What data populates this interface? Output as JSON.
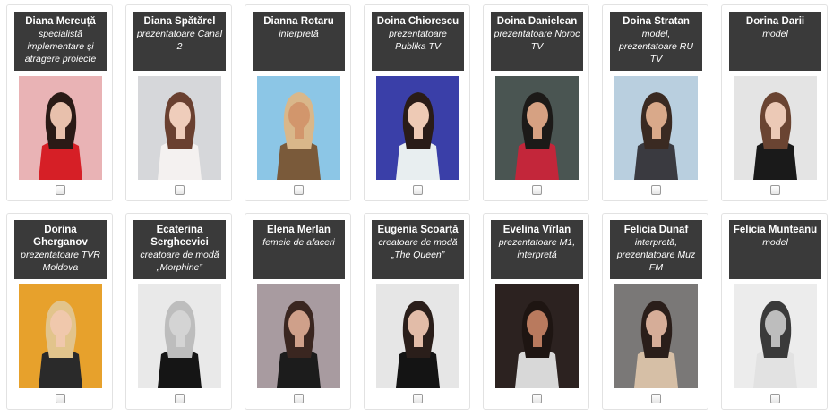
{
  "cards": [
    {
      "name": "Diana Mereuță",
      "role": "specialistă implementare și atragere proiecte",
      "checked": false,
      "colors": {
        "bg": "#e9b3b5",
        "hair": "#2a1a16",
        "skin": "#e8c0ac",
        "outfit": "#d61f26"
      }
    },
    {
      "name": "Diana Spătărel",
      "role": "prezentatoare Canal 2",
      "checked": false,
      "colors": {
        "bg": "#d6d7da",
        "hair": "#6a4030",
        "skin": "#efcdbb",
        "outfit": "#f4f1f0"
      }
    },
    {
      "name": "Dianna Rotaru",
      "role": "interpretă",
      "checked": false,
      "colors": {
        "bg": "#8cc6e6",
        "hair": "#d9b78a",
        "skin": "#d2966c",
        "outfit": "#7a5a3a"
      }
    },
    {
      "name": "Doina Chiorescu",
      "role": "prezentatoare Publika TV",
      "checked": false,
      "colors": {
        "bg": "#3a3fa8",
        "hair": "#2a1c18",
        "skin": "#eecab5",
        "outfit": "#e8eef0"
      }
    },
    {
      "name": "Doina Danielean",
      "role": "prezentatoare Noroc TV",
      "checked": false,
      "colors": {
        "bg": "#4a5552",
        "hair": "#1c1a18",
        "skin": "#d6a182",
        "outfit": "#c3263a"
      }
    },
    {
      "name": "Doina Stratan",
      "role": "model, prezentatoare RU TV",
      "checked": false,
      "colors": {
        "bg": "#b9cfdf",
        "hair": "#3a2a22",
        "skin": "#d9a98a",
        "outfit": "#3a3a40"
      }
    },
    {
      "name": "Dorina Darii",
      "role": "model",
      "checked": false,
      "colors": {
        "bg": "#e4e4e4",
        "hair": "#6a4432",
        "skin": "#ecc9b6",
        "outfit": "#1a1a1a"
      }
    },
    {
      "name": "Dorina Gherganov",
      "role": "prezentatoare TVR Moldova",
      "checked": false,
      "colors": {
        "bg": "#e7a12c",
        "hair": "#e2c48c",
        "skin": "#f0c8ac",
        "outfit": "#2a2a2a"
      }
    },
    {
      "name": "Ecaterina Sergheevici",
      "role": "creatoare de modă „Morphine”",
      "checked": false,
      "colors": {
        "bg": "#e9e9e9",
        "hair": "#bdbdbd",
        "skin": "#d4d4d4",
        "outfit": "#151515"
      }
    },
    {
      "name": "Elena Merlan",
      "role": "femeie de afaceri",
      "checked": false,
      "colors": {
        "bg": "#a89ba0",
        "hair": "#3a2620",
        "skin": "#cfa08a",
        "outfit": "#1c1c1c"
      }
    },
    {
      "name": "Eugenia Scoarță",
      "role": "creatoare de modă „The Queen”",
      "checked": false,
      "colors": {
        "bg": "#e6e6e6",
        "hair": "#2a1e1a",
        "skin": "#e2bca8",
        "outfit": "#141414"
      }
    },
    {
      "name": "Evelina Vîrlan",
      "role": "prezentatoare M1, interpretă",
      "checked": false,
      "colors": {
        "bg": "#2c2220",
        "hair": "#1e1512",
        "skin": "#b97a5e",
        "outfit": "#d8d8d8"
      }
    },
    {
      "name": "Felicia Dunaf",
      "role": "interpretă, prezentatoare Muz FM",
      "checked": false,
      "colors": {
        "bg": "#7a7877",
        "hair": "#2a1e1a",
        "skin": "#d6ad98",
        "outfit": "#d6bfa6"
      }
    },
    {
      "name": "Felicia Munteanu",
      "role": "model",
      "checked": false,
      "colors": {
        "bg": "#ececec",
        "hair": "#3a3a3a",
        "skin": "#bdbdbd",
        "outfit": "#e2e2e2"
      }
    }
  ]
}
